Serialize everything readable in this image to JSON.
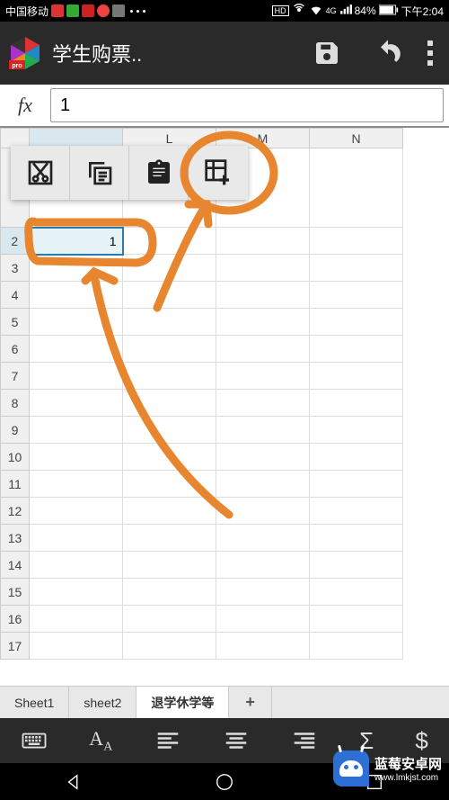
{
  "status": {
    "carrier": "中国移动",
    "battery_pct": "84%",
    "time": "下午2:04",
    "hd": "HD",
    "netgen": "4G"
  },
  "appbar": {
    "title": "学生购票.."
  },
  "formula": {
    "fx": "fx",
    "value": "1"
  },
  "columns": [
    "L",
    "M",
    "N"
  ],
  "rows": [
    "2",
    "3",
    "4",
    "5",
    "6",
    "7",
    "8",
    "9",
    "10",
    "11",
    "12",
    "13",
    "14",
    "15",
    "16",
    "17"
  ],
  "cell_value": "1",
  "ctx": {
    "cut": "cut",
    "copy": "copy",
    "paste": "paste",
    "insert": "insert"
  },
  "tabs": {
    "t1": "Sheet1",
    "t2": "sheet2",
    "t3": "退学休学等",
    "add": "+"
  },
  "toolbar": {
    "kb": "keyboard",
    "font": "font",
    "al": "align-left",
    "ac": "align-center",
    "ar": "align-right",
    "sum": "Σ",
    "cur": "$"
  },
  "watermark": {
    "name": "蓝莓安卓网",
    "url": "www.lmkjst.com"
  }
}
